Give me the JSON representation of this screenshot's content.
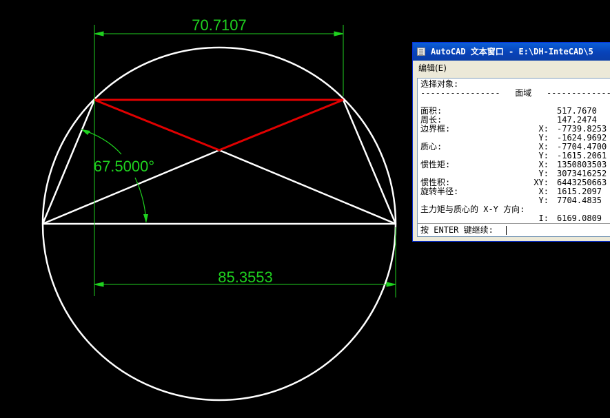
{
  "drawing": {
    "dimensions": {
      "top_width": "70.7107",
      "angle": "67.5000°",
      "bottom_width": "85.3553"
    },
    "colors": {
      "background": "#000000",
      "geometry": "#ffffff",
      "highlight": "#e00000",
      "dimension": "#1fd11f"
    }
  },
  "text_window": {
    "title": "AutoCAD 文本窗口 - E:\\DH-InteCAD\\5",
    "menu_edit": "编辑(E)",
    "select_prompt": "选择对象:",
    "section_header": "----------------   面域   ----------------",
    "rows": [
      {
        "label": "面积:",
        "axis": "",
        "value": "517.7670"
      },
      {
        "label": "周长:",
        "axis": "",
        "value": "147.2474"
      },
      {
        "label": "边界框:",
        "axis": "X:",
        "value": "-7739.8253"
      },
      {
        "label": "",
        "axis": "Y:",
        "value": "-1624.9692"
      },
      {
        "label": "质心:",
        "axis": "X:",
        "value": "-7704.4700"
      },
      {
        "label": "",
        "axis": "Y:",
        "value": "-1615.2061"
      },
      {
        "label": "惯性矩:",
        "axis": "X:",
        "value": "1350803503"
      },
      {
        "label": "",
        "axis": "Y:",
        "value": "3073416252"
      },
      {
        "label": "惯性积:",
        "axis": "XY:",
        "value": "6443250663"
      },
      {
        "label": "旋转半径:",
        "axis": "X:",
        "value": "1615.2097"
      },
      {
        "label": "",
        "axis": "Y:",
        "value": "7704.4835"
      },
      {
        "label": "主力矩与质心的 X-Y 方向:",
        "axis": "",
        "value": ""
      },
      {
        "label": "",
        "axis": "I:",
        "value": "6169.0809"
      }
    ],
    "prompt": "按 ENTER 键继续:"
  }
}
